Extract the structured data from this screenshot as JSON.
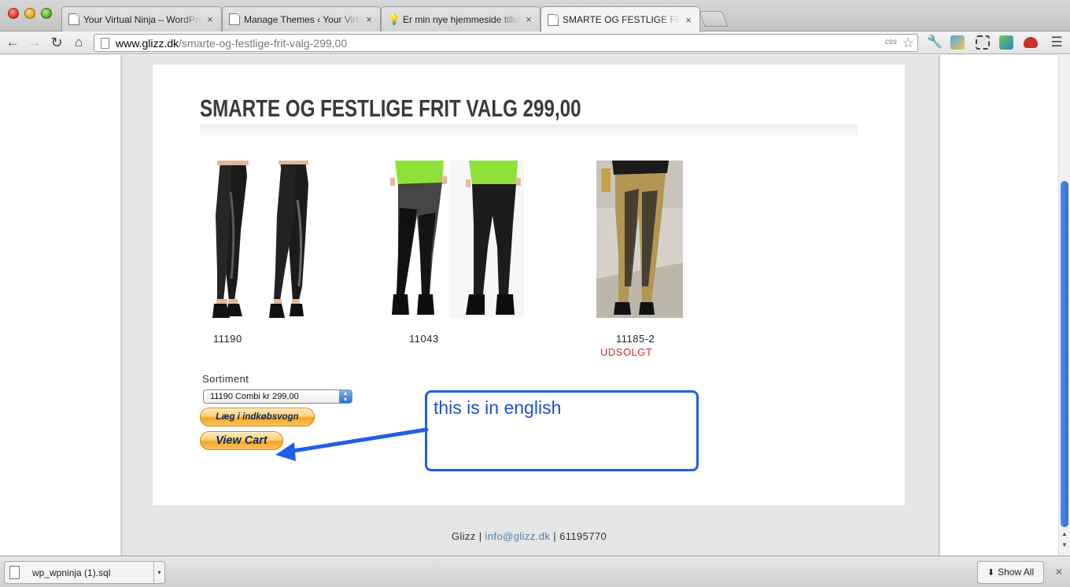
{
  "browser": {
    "tabs": [
      {
        "title": "Your Virtual Ninja – WordPress",
        "icon": "document-icon",
        "active": false
      },
      {
        "title": "Manage Themes ‹ Your Virtual Ninja",
        "icon": "document-icon",
        "active": false
      },
      {
        "title": "Er min nye hjemmeside tillid",
        "icon": "lightbulb-icon",
        "active": false
      },
      {
        "title": "SMARTE OG FESTLIGE FRIT VALG",
        "icon": "document-icon",
        "active": true
      }
    ],
    "tab_close_glyph": "×",
    "url_host": "www.glizz.dk",
    "url_path": "/smarte-og-festlige-frit-valg-299,00",
    "css_badge": "css"
  },
  "page": {
    "title": "SMARTE OG FESTLIGE FRIT VALG 299,00",
    "products": [
      {
        "code": "11190",
        "image": "black-leggings-photo"
      },
      {
        "code": "11043",
        "image": "green-top-sheer-leggings-photo"
      },
      {
        "code": "11185-2",
        "image": "gold-mesh-leggings-photo",
        "status": "UDSOLGT"
      }
    ],
    "sortiment_label": "Sortiment",
    "sortiment_selected": "11190 Combi kr 299,00",
    "add_to_cart_label": "Læg i indkøbsvogn",
    "view_cart_label": "View Cart",
    "annotation_text": "this is in english",
    "footer": {
      "brand": "Glizz",
      "sep1": " | ",
      "email": "info@glizz.dk",
      "sep2": " | ",
      "phone": "61195770"
    }
  },
  "download_shelf": {
    "filename": "wp_wpninja (1).sql",
    "show_all_label": "Show All"
  },
  "colors": {
    "soldout": "#d12b2b",
    "annotation": "#1f5fe8",
    "link": "#4a7fb5"
  }
}
